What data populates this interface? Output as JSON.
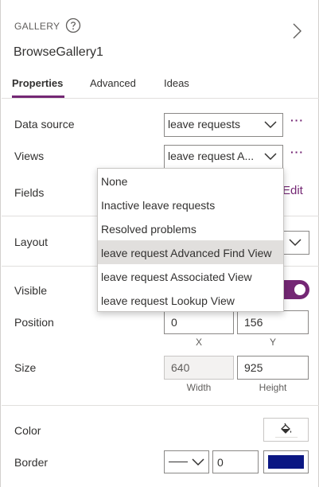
{
  "header": {
    "type_label": "GALLERY",
    "control_name": "BrowseGallery1"
  },
  "tabs": [
    {
      "label": "Properties",
      "active": true
    },
    {
      "label": "Advanced",
      "active": false
    },
    {
      "label": "Ideas",
      "active": false
    }
  ],
  "properties": {
    "data_source": {
      "label": "Data source",
      "value": "leave requests"
    },
    "views": {
      "label": "Views",
      "value": "leave request A..."
    },
    "fields": {
      "label": "Fields",
      "edit_label": "Edit"
    },
    "layout": {
      "label": "Layout"
    },
    "visible": {
      "label": "Visible",
      "on": true
    },
    "position": {
      "label": "Position",
      "x": "0",
      "y": "156",
      "x_caption": "X",
      "y_caption": "Y"
    },
    "size": {
      "label": "Size",
      "width": "640",
      "height": "925",
      "width_caption": "Width",
      "height_caption": "Height"
    },
    "color": {
      "label": "Color"
    },
    "border": {
      "label": "Border",
      "thickness": "0",
      "color": "#0b1783"
    }
  },
  "more_label": "···",
  "views_dropdown": {
    "options": [
      "None",
      "Inactive leave requests",
      "Resolved problems",
      "leave request Advanced Find View",
      "leave request Associated View",
      "leave request Lookup View"
    ],
    "hovered_index": 3
  },
  "colors": {
    "accent": "#742774",
    "border_color": "#0b1783"
  },
  "icons": {
    "help": "question-circle",
    "expand": "chevron-right",
    "dropdown": "chevron-down",
    "color": "paint-bucket"
  }
}
